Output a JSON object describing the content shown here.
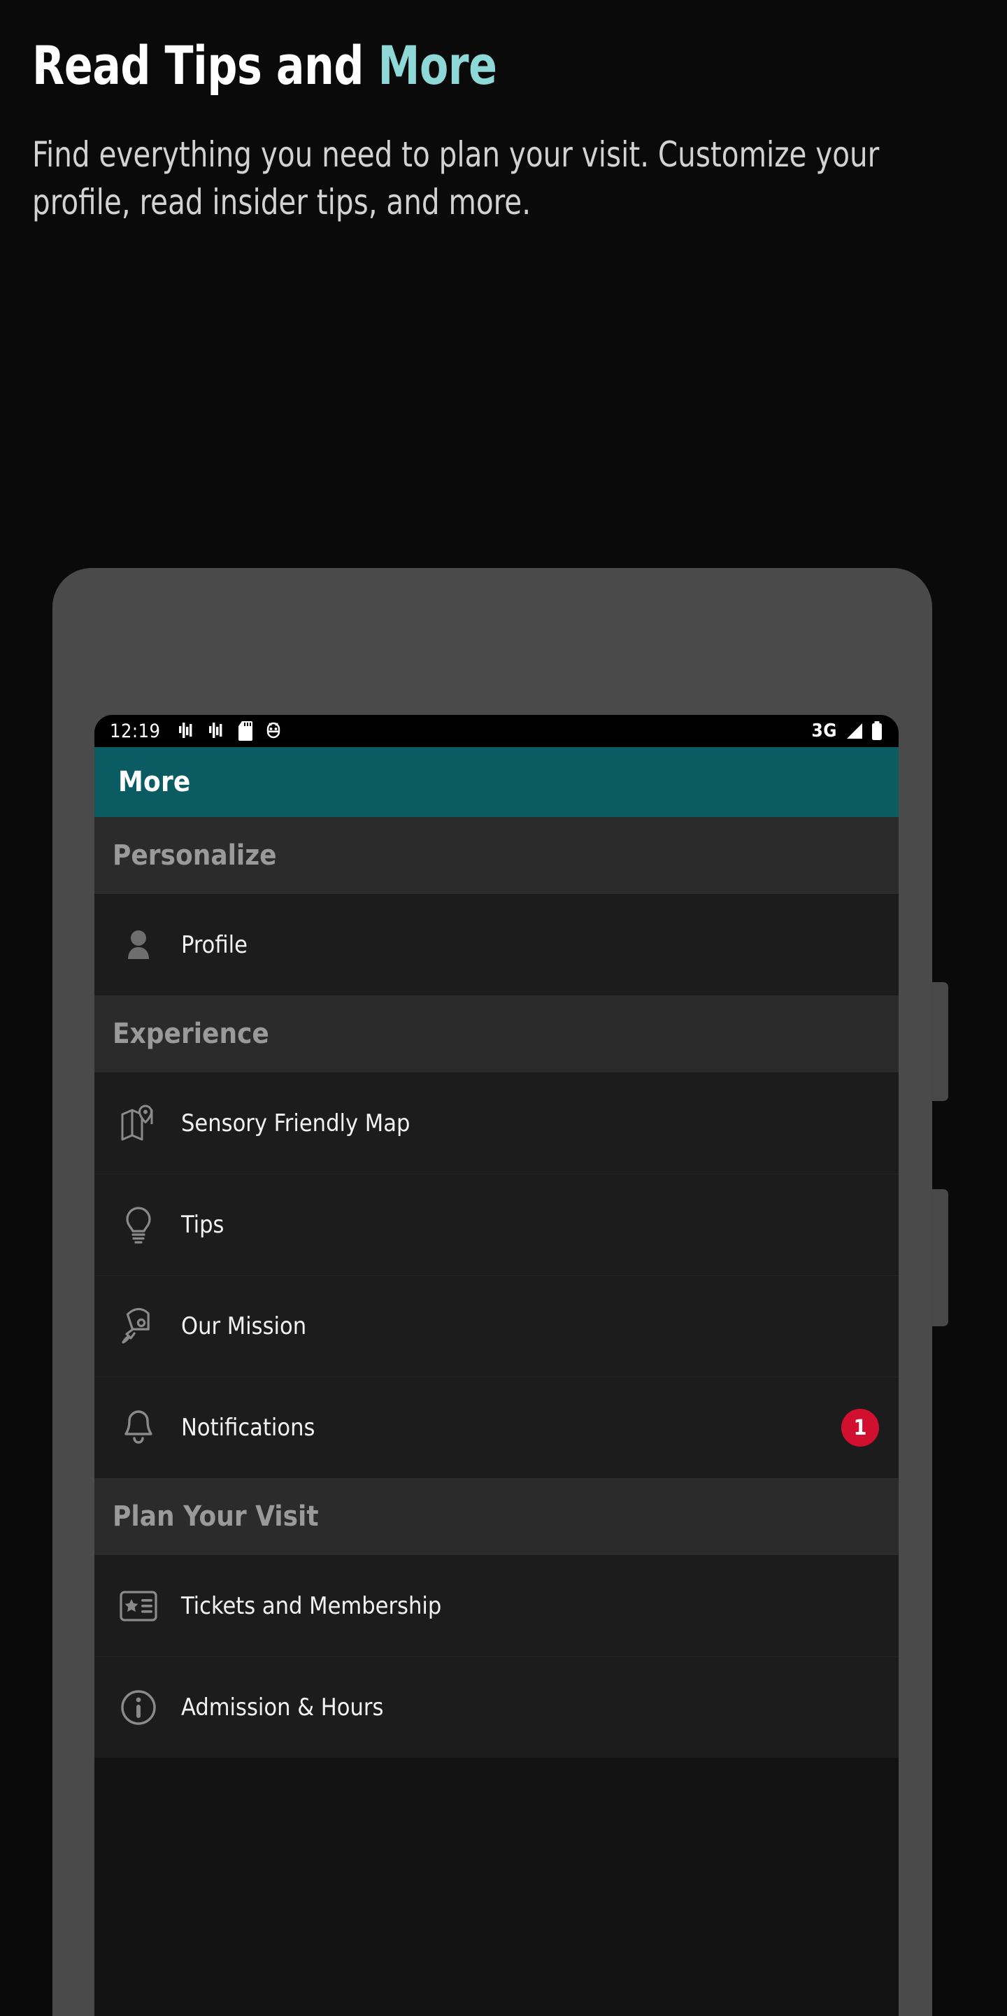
{
  "promo": {
    "headline_main": "Read Tips and ",
    "headline_accent": "More",
    "subcopy": "Find everything you need to plan your visit. Customize your profile, read insider tips, and more.",
    "accent_color": "#8FD8D8",
    "background_color": "#0A0A0A"
  },
  "phone": {
    "bezel_color": "#4A4A4A",
    "status_bar": {
      "time": "12:19",
      "network": "3G",
      "icons_left": [
        "vibrate-icon",
        "vibrate-icon",
        "sd-card-icon",
        "android-debug-icon"
      ],
      "icons_right": [
        "signal-icon",
        "battery-icon"
      ]
    },
    "app_bar": {
      "title": "More",
      "background_color": "#0A5C62"
    },
    "sections": [
      {
        "header": "Personalize",
        "items": [
          {
            "label": "Profile",
            "icon": "person-icon",
            "badge": null
          }
        ]
      },
      {
        "header": "Experience",
        "items": [
          {
            "label": "Sensory Friendly Map",
            "icon": "map-pin-icon",
            "badge": null
          },
          {
            "label": "Tips",
            "icon": "lightbulb-icon",
            "badge": null
          },
          {
            "label": "Our Mission",
            "icon": "rocket-icon",
            "badge": null
          },
          {
            "label": "Notifications",
            "icon": "bell-icon",
            "badge": "1"
          }
        ]
      },
      {
        "header": "Plan Your Visit",
        "items": [
          {
            "label": "Tickets and Membership",
            "icon": "ticket-icon",
            "badge": null
          },
          {
            "label": "Admission & Hours",
            "icon": "info-circle-icon",
            "badge": null
          }
        ]
      }
    ],
    "badge_color": "#D0102E"
  }
}
